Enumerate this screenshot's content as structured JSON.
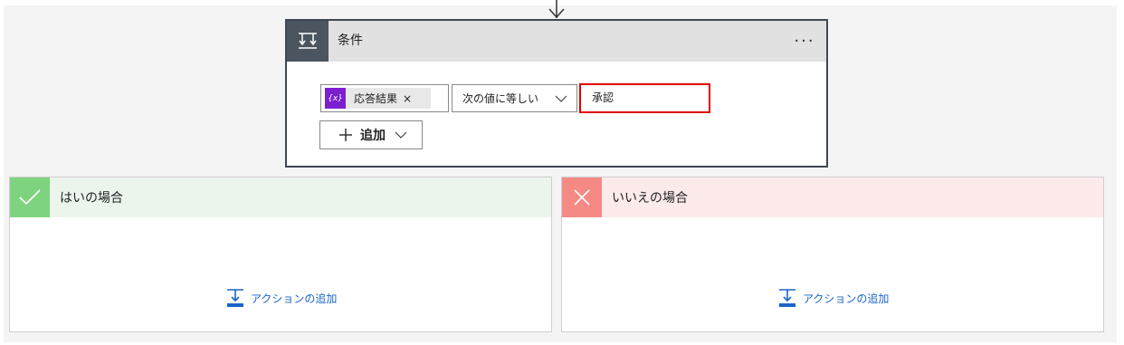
{
  "condition": {
    "title": "条件",
    "more_label": "···",
    "token": {
      "icon_text": "{x}",
      "label": "応答結果",
      "close": "×"
    },
    "operator": "次の値に等しい",
    "value": "承認",
    "add_label": "追加"
  },
  "branches": {
    "yes": {
      "title": "はいの場合",
      "add_action_label": "アクションの追加"
    },
    "no": {
      "title": "いいえの場合",
      "add_action_label": "アクションの追加"
    }
  },
  "colors": {
    "header_icon_bg": "#4a5560",
    "token_icon_bg": "#7b1fd0",
    "value_border": "#e00000",
    "yes_icon": "#7ed37f",
    "no_icon": "#f58a84",
    "link": "#1b64c8"
  },
  "icons": {
    "condition": "condition-icon",
    "yes": "checkmark-icon",
    "no": "cross-icon",
    "add_action": "add-action-icon"
  }
}
